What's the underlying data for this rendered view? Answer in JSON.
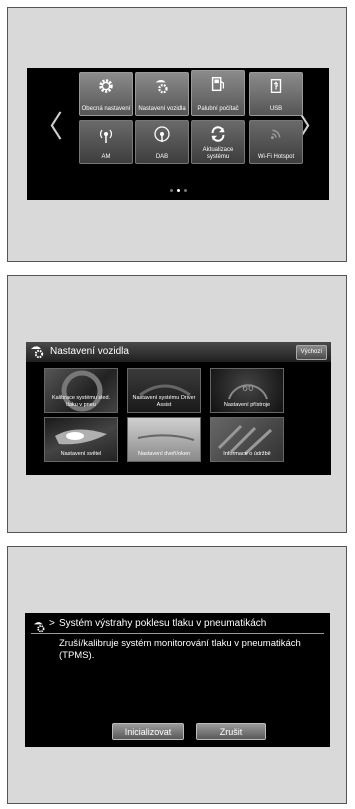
{
  "home": {
    "tiles": [
      {
        "label": "Obecná nastavení",
        "icon": "gear-icon"
      },
      {
        "label": "Nastavení vozidla",
        "icon": "car-settings-icon"
      },
      {
        "label": "Palubní počítač",
        "icon": "fuel-computer-icon"
      },
      {
        "label": "USB",
        "icon": "usb-icon"
      },
      {
        "label": "AM",
        "icon": "am-antenna-icon"
      },
      {
        "label": "DAB",
        "icon": "dab-antenna-icon"
      },
      {
        "label": "Aktualizace systému",
        "icon": "refresh-icon"
      },
      {
        "label": "Wi-Fi Hotspot",
        "icon": "wifi-icon"
      }
    ],
    "prev_arrow": "〈",
    "next_arrow": "〉",
    "page_index": 2,
    "page_count": 3
  },
  "vehicle": {
    "title": "Nastavení vozidla",
    "default_button": "Výchozí",
    "cards": [
      {
        "label": "Kalibrace systému sled. tlaku v pneu"
      },
      {
        "label": "Nastavení systému Driver Assist"
      },
      {
        "label": "Nastavení přístroje"
      },
      {
        "label": "Nastavení světel"
      },
      {
        "label": "Nastavení dveří/oken"
      },
      {
        "label": "Informace o údržbě"
      }
    ]
  },
  "tpms": {
    "breadcrumb_sep": ">",
    "title": "Systém výstrahy poklesu tlaku v pneumatikách",
    "body": "Zruší/kalibruje systém monitorování tlaku v pneumatikách (TPMS).",
    "init_button": "Inicializovat",
    "cancel_button": "Zrušit"
  }
}
